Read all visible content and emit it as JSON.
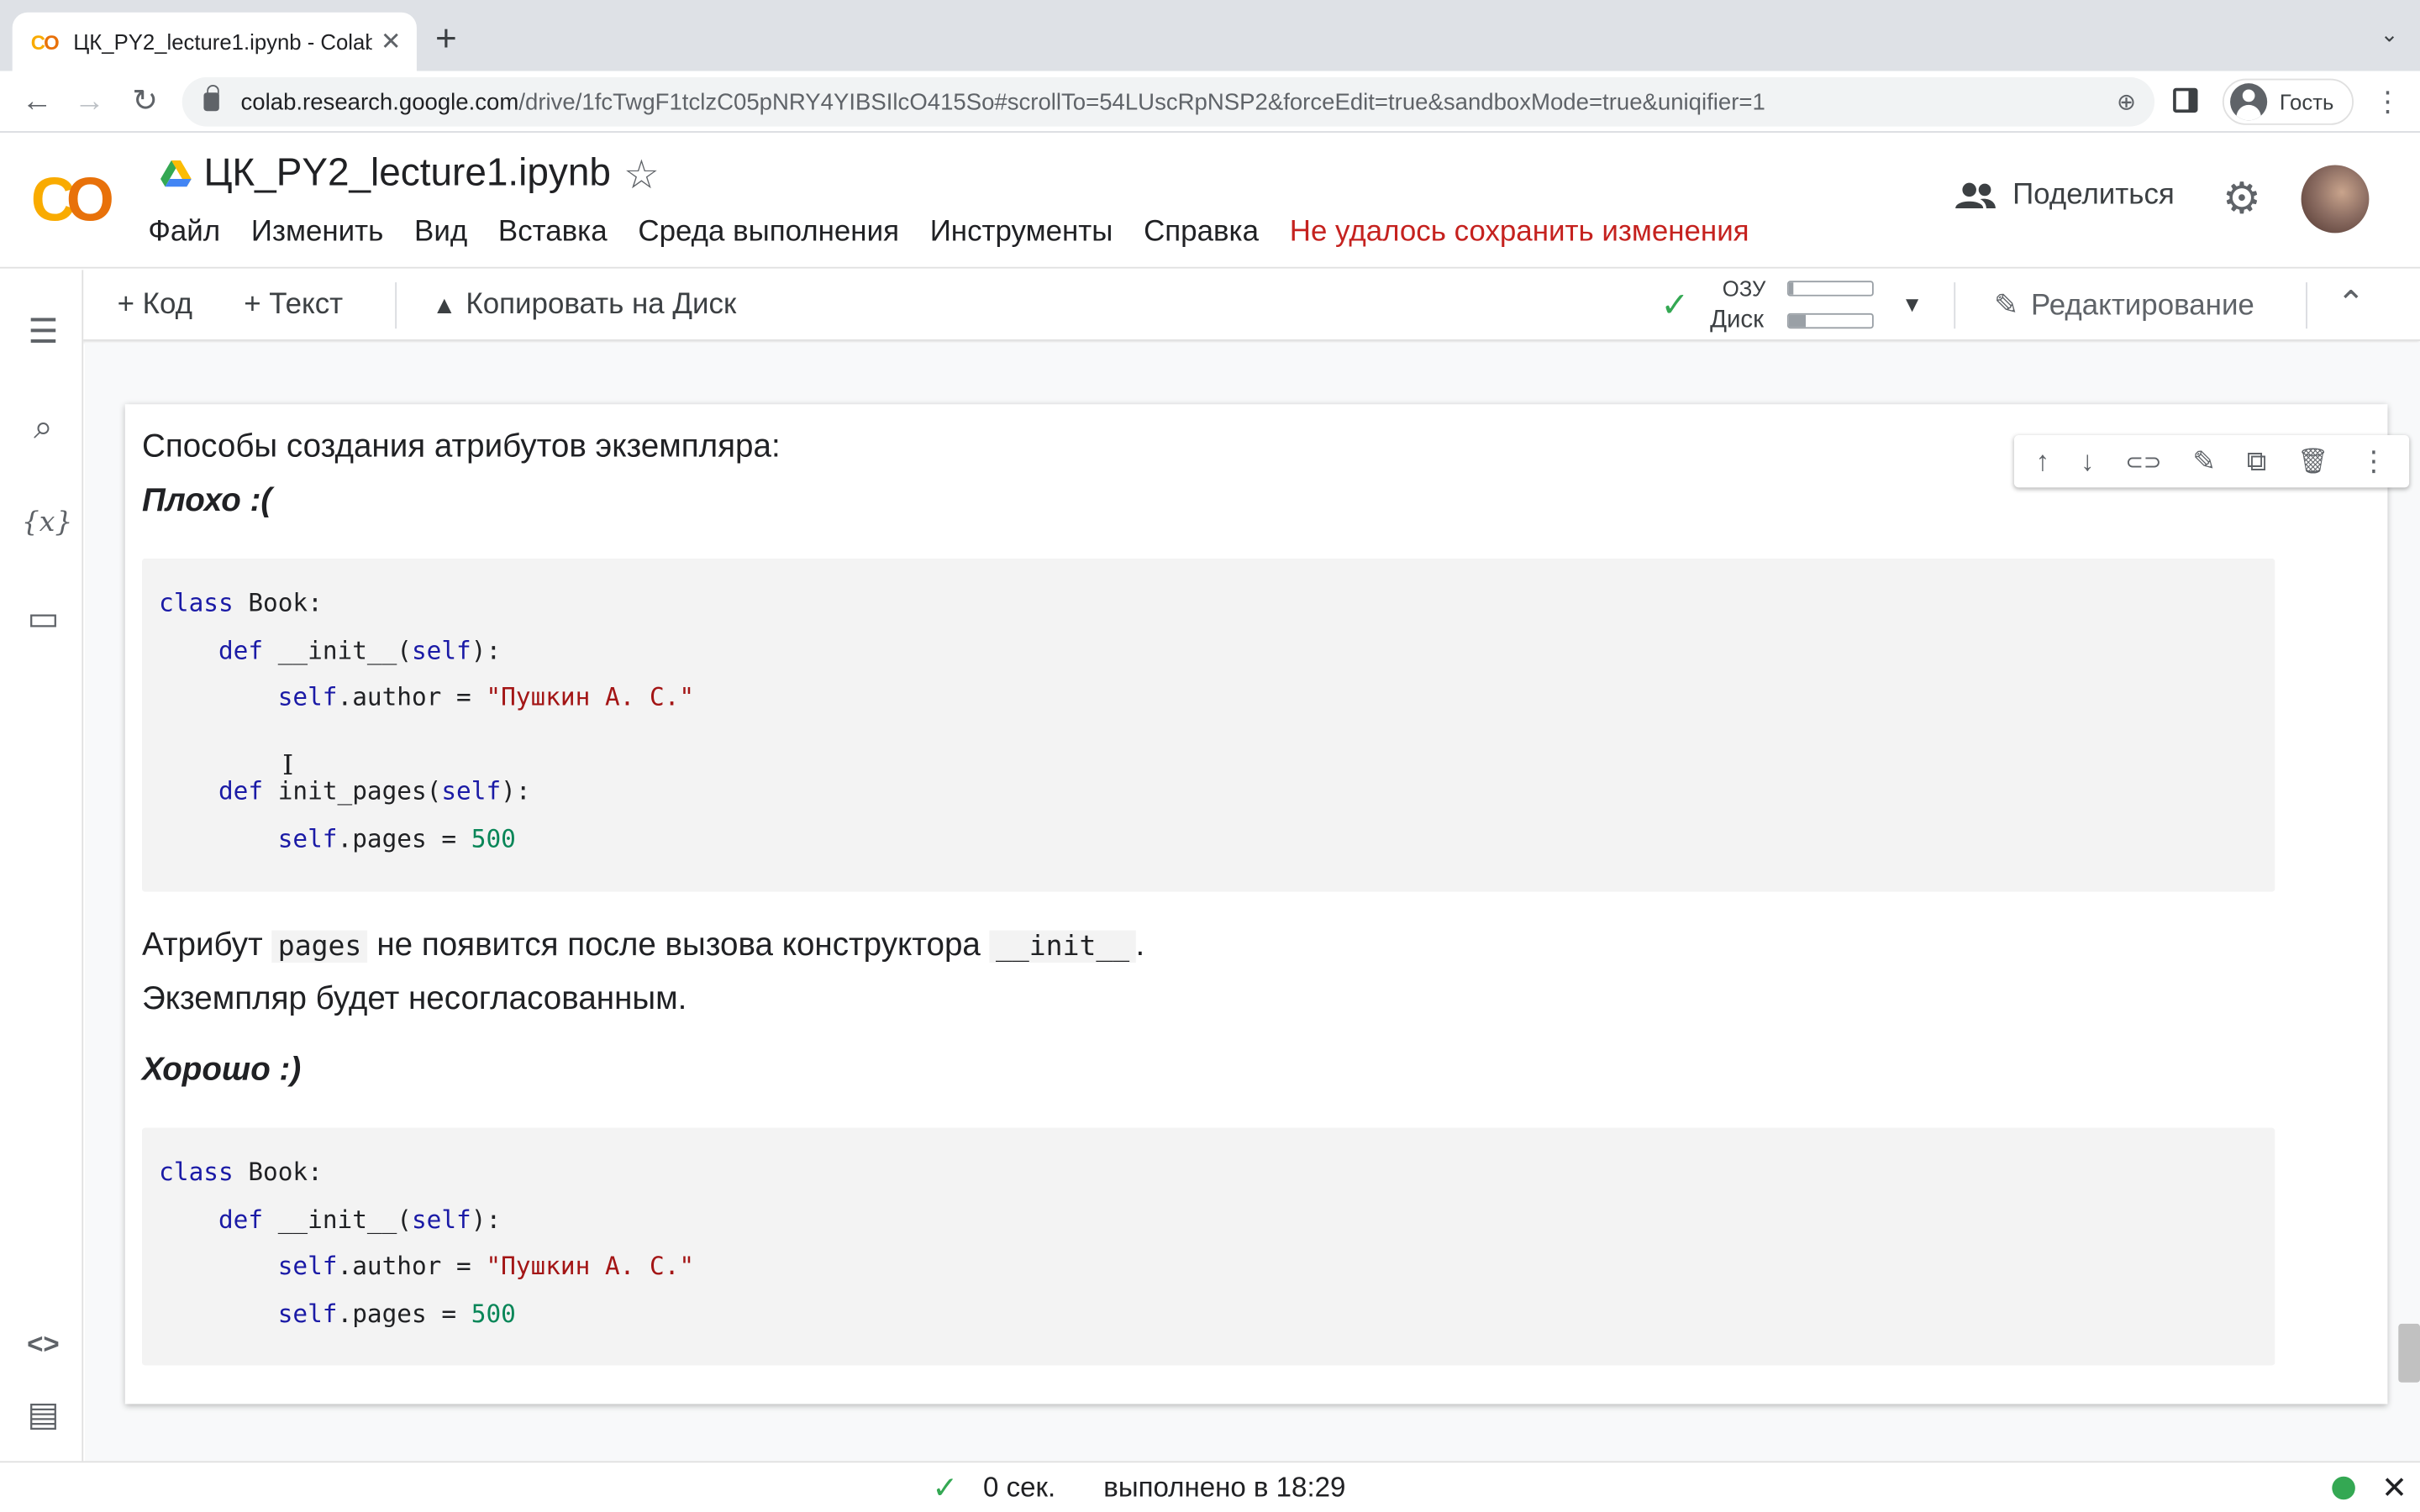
{
  "browser": {
    "tab_title": "ЦК_PY2_lecture1.ipynb - Colab",
    "tab_favicon": "CO",
    "new_tab": "+",
    "tab_menu": "⌄",
    "back": "←",
    "forward": "→",
    "reload": "↻",
    "url_host": "colab.research.google.com",
    "url_path": "/drive/1fcTwgF1tclzC05pNRY4YIBSIlcO415So#scrollTo=54LUscRpNSP2&forceEdit=true&sandboxMode=true&uniqifier=1",
    "profile_name": "Гость",
    "kebab": "⋮"
  },
  "header": {
    "logo": "CO",
    "notebook_title": "ЦК_PY2_lecture1.ipynb",
    "star": "☆",
    "menu": [
      "Файл",
      "Изменить",
      "Вид",
      "Вставка",
      "Среда выполнения",
      "Инструменты",
      "Справка"
    ],
    "save_warning": "Не удалось сохранить изменения",
    "share_label": "Поделиться",
    "share_icon": "people-icon",
    "gear": "⚙"
  },
  "toolbar": {
    "add_code": "+ Код",
    "add_text": "+ Текст",
    "copy_to_drive": "Копировать на Диск",
    "ram_label": "ОЗУ",
    "disk_label": "Диск",
    "ram_usage": 0.05,
    "disk_usage": 0.2,
    "caret": "▼",
    "editing": "Редактирование",
    "collapse": "⌃"
  },
  "rail": {
    "icons": [
      "toc-icon",
      "search-icon",
      "variables-icon",
      "folder-icon",
      "code-snippets-icon",
      "terminal-icon"
    ],
    "toc": "☰",
    "search": "⌕",
    "vars": "{x}",
    "folder": "▭",
    "snippets": "<>",
    "terminal": "▤"
  },
  "cell": {
    "actions": {
      "up": "↑",
      "down": "↓",
      "link": "⊂⊃",
      "edit": "✎",
      "mirror": "⧉",
      "delete": "🗑",
      "more": "⋮"
    },
    "heading": "Способы создания атрибутов экземпляра:",
    "bad_label": "Плохо :(",
    "bad_code": {
      "l1_kw": "class",
      "l1_rest": " Book:",
      "l2_indent": "    ",
      "l2_kw": "def",
      "l2_name": " __init__(",
      "l2_self": "self",
      "l2_end": "):",
      "l3_indent": "        ",
      "l3_self": "self",
      "l3_mid": ".author = ",
      "l3_str": "\"Пушкин А. С.\"",
      "l5_indent": "    ",
      "l5_kw": "def",
      "l5_name": " init_pages(",
      "l5_self": "self",
      "l5_end": "):",
      "l6_indent": "        ",
      "l6_self": "self",
      "l6_mid": ".pages = ",
      "l6_num": "500"
    },
    "para1_a": "Атрибут ",
    "para1_code1": "pages",
    "para1_b": " не появится после вызова конструктора ",
    "para1_code2": "__init__",
    "para1_c": ".",
    "para2": "Экземпляр будет несогласованным.",
    "good_label": "Хорошо :)",
    "good_code": {
      "l1_kw": "class",
      "l1_rest": " Book:",
      "l2_indent": "    ",
      "l2_kw": "def",
      "l2_name": " __init__(",
      "l2_self": "self",
      "l2_end": "):",
      "l3_indent": "        ",
      "l3_self": "self",
      "l3_mid": ".author = ",
      "l3_str": "\"Пушкин А. С.\"",
      "l4_indent": "        ",
      "l4_self": "self",
      "l4_mid": ".pages = ",
      "l4_num": "500"
    }
  },
  "status": {
    "check": "✓",
    "duration": "0 сек.",
    "completed": "выполнено в 18:29",
    "close": "✕"
  },
  "colors": {
    "keyword": "#1a1aa6",
    "string": "#a31515",
    "number": "#098658",
    "warning": "#c5221f",
    "ok": "#34a853"
  }
}
